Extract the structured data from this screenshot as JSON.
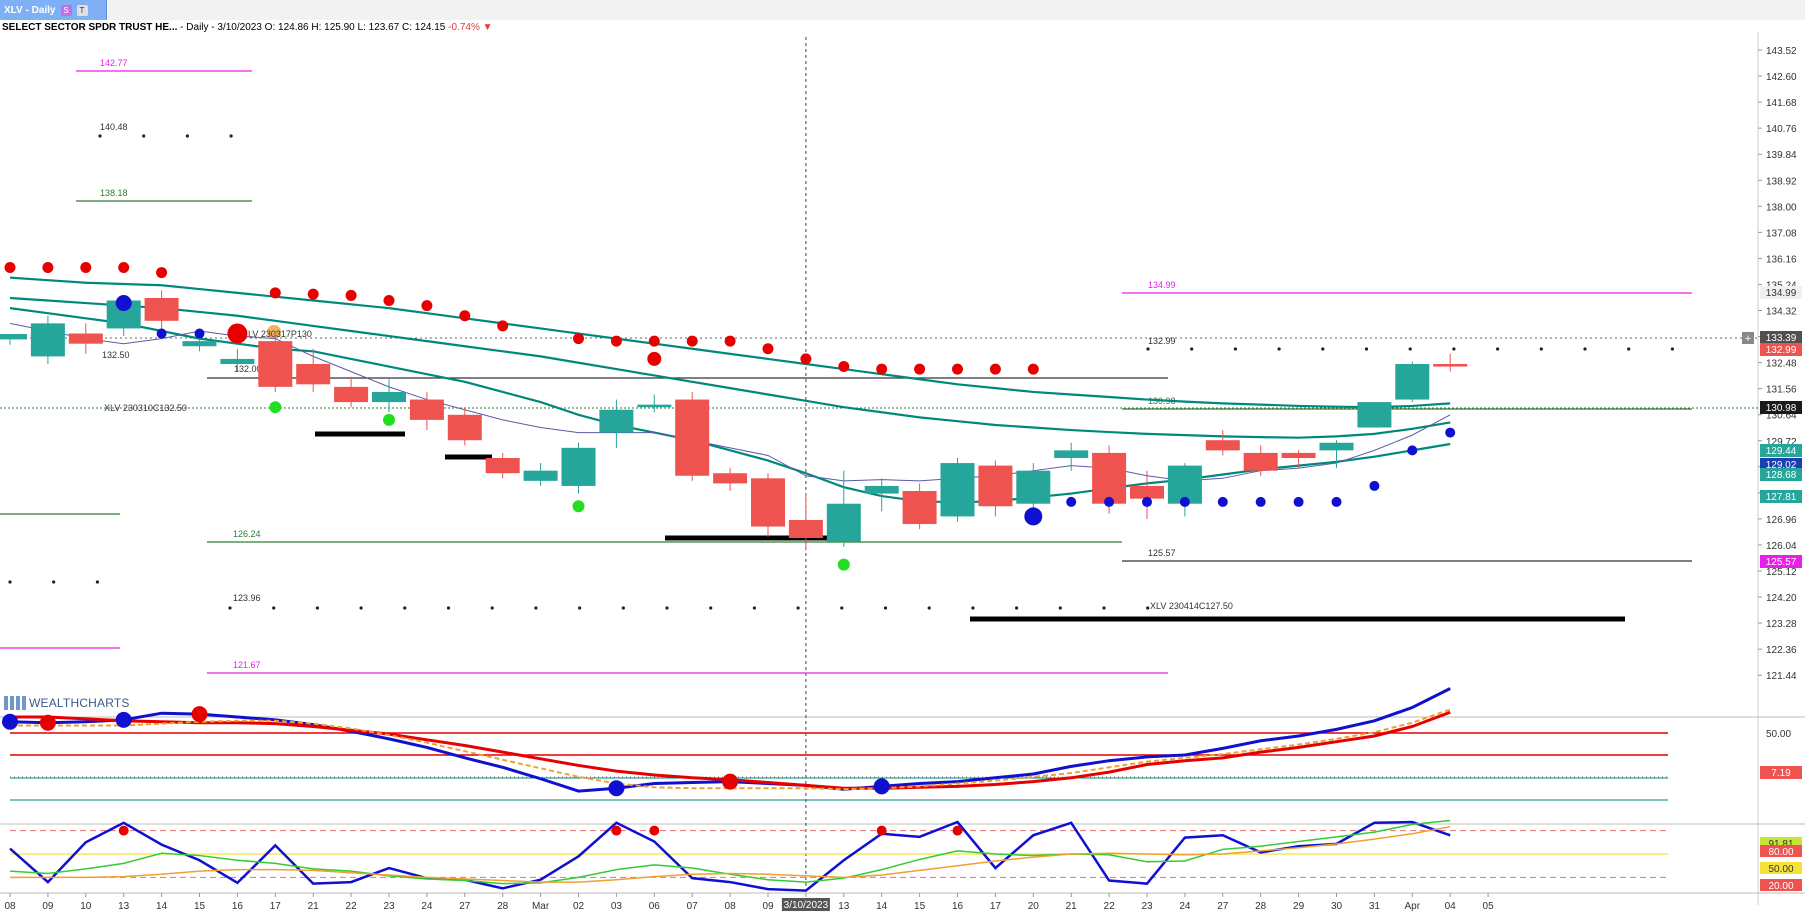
{
  "tab": {
    "label": "XLV - Daily",
    "badge_s": "S",
    "badge_t": "T"
  },
  "header": {
    "symbol_name": "SELECT SECTOR SPDR TRUST HE...",
    "interval_date": "- Daily - 3/10/2023",
    "ohlc": "O: 124.86 H: 125.90 L: 123.67 C: 124.15",
    "change": "-0.74%"
  },
  "watermark": "WEALTHCHARTS",
  "colors": {
    "up": "#26a69a",
    "down": "#ef5350",
    "ma": "#00897b",
    "magenta": "#e91ee9",
    "green": "#2e7d32",
    "blue": "#1010d0"
  },
  "chart_data": [
    {
      "type": "candlestick",
      "y_ticks": [
        "143.52",
        "142.60",
        "141.68",
        "140.76",
        "139.84",
        "138.92",
        "138.00",
        "137.08",
        "136.16",
        "135.24",
        "134.32",
        "133.40",
        "132.48",
        "131.56",
        "130.64",
        "129.72",
        "128.80",
        "127.88",
        "126.96",
        "126.04",
        "125.12",
        "124.20",
        "123.28",
        "122.36",
        "121.44"
      ],
      "x_ticks": [
        "08",
        "09",
        "10",
        "13",
        "14",
        "15",
        "16",
        "17",
        "21",
        "22",
        "23",
        "24",
        "27",
        "28",
        "Mar",
        "02",
        "03",
        "06",
        "07",
        "08",
        "09",
        "3/10/2023",
        "13",
        "14",
        "15",
        "16",
        "17",
        "20",
        "21",
        "22",
        "23",
        "24",
        "27",
        "28",
        "29",
        "30",
        "31",
        "Apr",
        "04",
        "05"
      ],
      "price_tags": [
        {
          "label": "134.99",
          "bg": "#f0f0f0",
          "fg": "#333"
        },
        {
          "label": "133.39",
          "bg": "#505050",
          "fg": "#fff"
        },
        {
          "label": "132.99",
          "bg": "#ef5350",
          "fg": "#fff"
        },
        {
          "label": "130.98",
          "bg": "#1a1a1a",
          "fg": "#fff"
        },
        {
          "label": "129.44",
          "bg": "#26a69a",
          "fg": "#fff"
        },
        {
          "label": "129.02",
          "bg": "#1a3fb0",
          "fg": "#fff"
        },
        {
          "label": "128.68",
          "bg": "#26a69a",
          "fg": "#fff"
        },
        {
          "label": "127.81",
          "bg": "#26a69a",
          "fg": "#fff"
        },
        {
          "label": "125.57",
          "bg": "#e91ee9",
          "fg": "#fff"
        }
      ],
      "level_labels": [
        "142.77",
        "140.48",
        "138.18",
        "134.99",
        "132.99",
        "130.98",
        "132.50",
        "132.00",
        "126.24",
        "125.57",
        "123.96",
        "121.67"
      ],
      "option_labels": [
        "XLV 230317P130",
        "XLV 230310C132.50",
        "XLV 230414C127.50"
      ],
      "candles": [
        [
          131.97,
          132.18,
          131.76,
          132.05
        ],
        [
          131.3,
          132.6,
          131.0,
          132.9
        ],
        [
          132.2,
          131.8,
          131.4,
          132.6
        ],
        [
          132.4,
          133.5,
          132.1,
          133.7
        ],
        [
          133.6,
          132.7,
          132.2,
          133.9
        ],
        [
          131.7,
          131.9,
          131.5,
          132.1
        ],
        [
          131.0,
          131.2,
          130.7,
          131.6
        ],
        [
          131.9,
          130.1,
          129.9,
          132.2
        ],
        [
          131.0,
          130.2,
          129.9,
          131.6
        ],
        [
          130.1,
          129.5,
          129.3,
          130.5
        ],
        [
          129.5,
          129.9,
          129.1,
          130.4
        ],
        [
          129.6,
          128.8,
          128.4,
          129.9
        ],
        [
          129.0,
          128.0,
          127.8,
          129.3
        ],
        [
          127.3,
          126.7,
          126.5,
          127.5
        ],
        [
          126.4,
          126.8,
          126.2,
          127.1
        ],
        [
          126.2,
          127.7,
          125.9,
          127.9
        ],
        [
          128.3,
          129.2,
          127.7,
          129.6
        ],
        [
          129.3,
          129.4,
          129.1,
          129.8
        ],
        [
          129.6,
          126.6,
          126.4,
          129.9
        ],
        [
          126.7,
          126.3,
          126.0,
          126.9
        ],
        [
          126.5,
          124.6,
          124.2,
          126.7
        ],
        [
          124.86,
          124.15,
          123.67,
          125.9
        ],
        [
          124.0,
          125.5,
          123.8,
          126.8
        ],
        [
          125.9,
          126.2,
          125.2,
          126.5
        ],
        [
          126.0,
          124.7,
          124.5,
          126.3
        ],
        [
          125.0,
          127.1,
          124.8,
          127.3
        ],
        [
          127.0,
          125.4,
          125.0,
          127.2
        ],
        [
          125.5,
          126.8,
          125.3,
          127.1
        ],
        [
          127.3,
          127.6,
          126.8,
          127.9
        ],
        [
          127.5,
          125.5,
          125.1,
          127.8
        ],
        [
          126.2,
          125.7,
          124.9,
          126.8
        ],
        [
          125.5,
          127.0,
          125.0,
          127.1
        ],
        [
          128.0,
          127.6,
          127.4,
          128.4
        ],
        [
          127.5,
          126.8,
          126.6,
          127.8
        ],
        [
          127.5,
          127.3,
          126.9,
          127.6
        ],
        [
          127.6,
          127.9,
          126.9,
          128.0
        ],
        [
          128.5,
          129.5,
          128.5,
          129.5
        ],
        [
          129.6,
          131.0,
          129.5,
          131.1
        ],
        [
          131.0,
          130.9,
          130.7,
          131.4
        ]
      ],
      "ma_long": [
        134.4,
        134.3,
        134.2,
        134.15,
        134.1,
        133.95,
        133.8,
        133.65,
        133.5,
        133.35,
        133.2,
        133.0,
        132.8,
        132.6,
        132.4,
        132.2,
        132.0,
        131.8,
        131.6,
        131.4,
        131.2,
        131.0,
        130.8,
        130.6,
        130.4,
        130.2,
        130.05,
        129.9,
        129.8,
        129.7,
        129.6,
        129.52,
        129.45,
        129.4,
        129.35,
        129.32,
        129.3,
        129.35,
        129.45
      ],
      "ma_mid": [
        133.6,
        133.5,
        133.4,
        133.3,
        133.2,
        133.05,
        132.9,
        132.7,
        132.5,
        132.3,
        132.1,
        131.9,
        131.7,
        131.5,
        131.3,
        131.05,
        130.8,
        130.55,
        130.3,
        130.05,
        129.8,
        129.55,
        129.3,
        129.1,
        128.9,
        128.75,
        128.6,
        128.5,
        128.4,
        128.32,
        128.25,
        128.2,
        128.15,
        128.12,
        128.1,
        128.15,
        128.25,
        128.45,
        128.7
      ],
      "ma_short": [
        133.2,
        133.0,
        132.8,
        132.6,
        132.3,
        132.0,
        131.8,
        131.6,
        131.5,
        131.2,
        130.9,
        130.6,
        130.3,
        129.9,
        129.5,
        129.0,
        128.6,
        128.3,
        128.0,
        127.6,
        127.2,
        126.7,
        126.15,
        125.8,
        125.6,
        125.55,
        125.6,
        125.75,
        125.9,
        126.1,
        126.3,
        126.45,
        126.65,
        126.85,
        127.0,
        127.15,
        127.35,
        127.6,
        127.85
      ],
      "thin_line": [
        132.6,
        132.3,
        132.0,
        131.8,
        132.0,
        132.3,
        132.1,
        132.0,
        131.3,
        130.7,
        130.1,
        129.6,
        129.2,
        128.8,
        128.5,
        128.3,
        128.3,
        128.3,
        128.0,
        127.7,
        127.4,
        126.6,
        126.4,
        126.45,
        126.4,
        126.5,
        126.6,
        126.8,
        127.0,
        126.9,
        126.6,
        126.4,
        126.5,
        126.8,
        126.9,
        127.1,
        127.6,
        128.2,
        129.0
      ],
      "red_dots": [
        134.8,
        134.8,
        134.8,
        134.8,
        134.6,
        null,
        null,
        133.8,
        133.75,
        133.7,
        133.5,
        133.3,
        132.9,
        132.5,
        null,
        132.0,
        131.9,
        131.9,
        131.9,
        131.9,
        131.6,
        131.2,
        130.9,
        130.8,
        130.8,
        130.8,
        130.8,
        130.8,
        null,
        null,
        null,
        null,
        null,
        null,
        null,
        null,
        null,
        null,
        null
      ],
      "blue_dots": [
        null,
        null,
        null,
        null,
        132.2,
        132.2,
        132.2,
        null,
        null,
        null,
        null,
        null,
        null,
        null,
        null,
        null,
        null,
        null,
        null,
        null,
        null,
        null,
        null,
        null,
        null,
        null,
        null,
        null,
        125.57,
        125.57,
        125.57,
        125.57,
        125.57,
        125.57,
        125.57,
        125.57,
        126.2,
        127.6,
        128.3
      ]
    },
    {
      "type": "line",
      "y_ticks": [
        "50.00"
      ],
      "tags": [
        {
          "label": "7.19",
          "bg": "#ef5350",
          "fg": "#fff"
        }
      ],
      "series": [
        {
          "values": [
            -0.5,
            -0.6,
            -0.5,
            -0.3,
            0.4,
            0.3,
            0.0,
            -0.3,
            -0.8,
            -1.5,
            -2.3,
            -3.2,
            -4.3,
            -5.3,
            -6.5,
            -7.8,
            -7.5,
            -7.0,
            -6.9,
            -6.8,
            -7.0,
            -7.2,
            -7.6,
            -7.3,
            -7.0,
            -6.8,
            -6.4,
            -6.0,
            -5.2,
            -4.6,
            -4.2,
            -4.0,
            -3.3,
            -2.5,
            -2.0,
            -1.3,
            -0.4,
            1.0,
            3.0
          ]
        },
        {
          "values": [
            0.0,
            0.0,
            -0.2,
            -0.4,
            -0.5,
            -0.6,
            -0.6,
            -0.7,
            -1.0,
            -1.4,
            -1.8,
            -2.4,
            -3.0,
            -3.7,
            -4.4,
            -5.1,
            -5.7,
            -6.1,
            -6.4,
            -6.6,
            -6.9,
            -7.2,
            -7.5,
            -7.5,
            -7.4,
            -7.3,
            -7.1,
            -6.8,
            -6.4,
            -5.8,
            -5.0,
            -4.6,
            -4.3,
            -3.7,
            -3.2,
            -2.6,
            -2.0,
            -1.0,
            0.5
          ]
        },
        {
          "values": [
            -0.9,
            -0.9,
            -0.9,
            -0.9,
            -0.7,
            -0.5,
            -0.4,
            -0.4,
            -0.7,
            -1.2,
            -1.9,
            -2.7,
            -3.6,
            -4.5,
            -5.4,
            -6.3,
            -7.0,
            -7.4,
            -7.5,
            -7.5,
            -7.5,
            -7.5,
            -7.6,
            -7.5,
            -7.3,
            -7.0,
            -6.7,
            -6.3,
            -5.9,
            -5.3,
            -4.7,
            -4.3,
            -3.9,
            -3.4,
            -2.9,
            -2.3,
            -1.6,
            -0.6,
            0.8
          ]
        }
      ]
    },
    {
      "type": "line",
      "y_ticks": [
        "80.00",
        "50.00",
        "20.00"
      ],
      "tags": [
        {
          "label": "91.81",
          "bg": "#c6e33a",
          "fg": "#333"
        },
        {
          "label": "80.00",
          "bg": "#ef5350",
          "fg": "#fff"
        },
        {
          "label": "50.00",
          "bg": "#f5e33a",
          "fg": "#333"
        },
        {
          "label": "20.00",
          "bg": "#ef5350",
          "fg": "#fff"
        }
      ],
      "series": [
        {
          "values": [
            57,
            14,
            65,
            90,
            62,
            42,
            13,
            61,
            12,
            14,
            32,
            19,
            17,
            6,
            17,
            47,
            90,
            66,
            19,
            14,
            5,
            3,
            42,
            76,
            72,
            91,
            32,
            74,
            90,
            16,
            12,
            71,
            74,
            52,
            60,
            63,
            90,
            91,
            74
          ]
        },
        {
          "values": [
            28,
            25,
            31,
            38,
            51,
            48,
            42,
            38,
            31,
            28,
            22,
            18,
            16,
            12,
            13,
            20,
            30,
            36,
            32,
            24,
            17,
            14,
            19,
            30,
            43,
            54,
            50,
            48,
            50,
            49,
            40,
            41,
            56,
            60,
            66,
            72,
            78,
            88,
            93
          ]
        },
        {
          "values": [
            20,
            20,
            20,
            21,
            24,
            28,
            30,
            30,
            29,
            26,
            23,
            20,
            18,
            16,
            14,
            14,
            17,
            21,
            24,
            25,
            24,
            22,
            20,
            23,
            29,
            35,
            41,
            46,
            50,
            51,
            50,
            49,
            50,
            54,
            58,
            63,
            69,
            76,
            85
          ]
        }
      ]
    }
  ]
}
